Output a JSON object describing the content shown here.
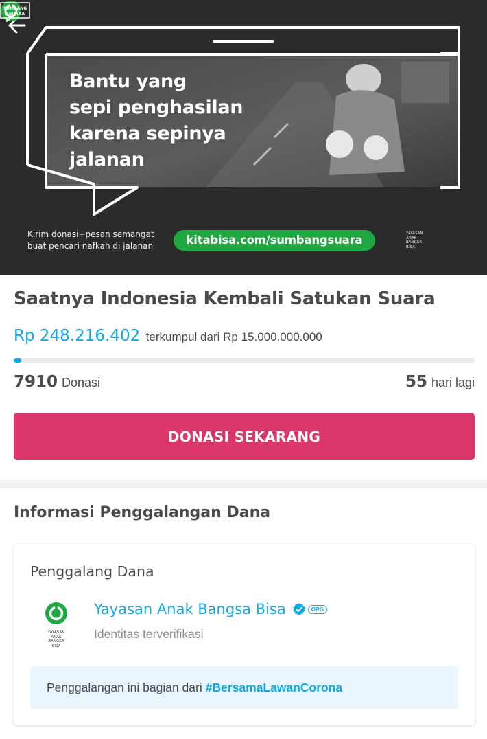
{
  "banner": {
    "headline_lines": [
      "Bantu yang",
      "sepi penghasilan",
      "karena sepinya",
      "jalanan"
    ],
    "caption_lines": [
      "Kirim donasi+pesan semangat",
      "buat pencari nafkah di jalanan"
    ],
    "url": "kitabisa.com/sumbangsuara",
    "org_logo_lines": [
      "YAYASAN",
      "ANAK",
      "BANGSA",
      "BISA"
    ],
    "sumbang_suara_label": "SUMBANG SUARA",
    "icons": {
      "back": "arrow-left-icon"
    }
  },
  "campaign": {
    "title": "Saatnya Indonesia Kembali Satukan Suara",
    "amount_collected": "Rp 248.216.402",
    "amount_target_text": "terkumpul dari Rp 15.000.000.000",
    "progress_fraction": 0.0165,
    "donation_count": "7910",
    "donation_label": "Donasi",
    "days_left": "55",
    "days_left_label": "hari lagi",
    "donate_button_label": "DONASI SEKARANG"
  },
  "info": {
    "heading": "Informasi Penggalangan Dana",
    "card_heading": "Penggalang Dana",
    "org_name": "Yayasan Anak Bangsa Bisa",
    "org_badge": "ORG",
    "org_status": "Identitas terverifikasi",
    "org_logo_lines": [
      "YAYASAN",
      "ANAK",
      "BANGSA",
      "BISA"
    ],
    "note_text": "Penggalangan ini bagian dari",
    "note_tag": "#BersamaLawanCorona",
    "icons": {
      "verified": "verified-check-icon",
      "logo": "yayasan-logo-icon"
    }
  },
  "colors": {
    "accent_blue": "#10a8e5",
    "donate_pink": "#db366a",
    "banner_green": "#1fa83f",
    "text_dark": "#4a4a4a",
    "text_muted": "#8c8c8c",
    "note_bg": "#eaf6fd"
  }
}
